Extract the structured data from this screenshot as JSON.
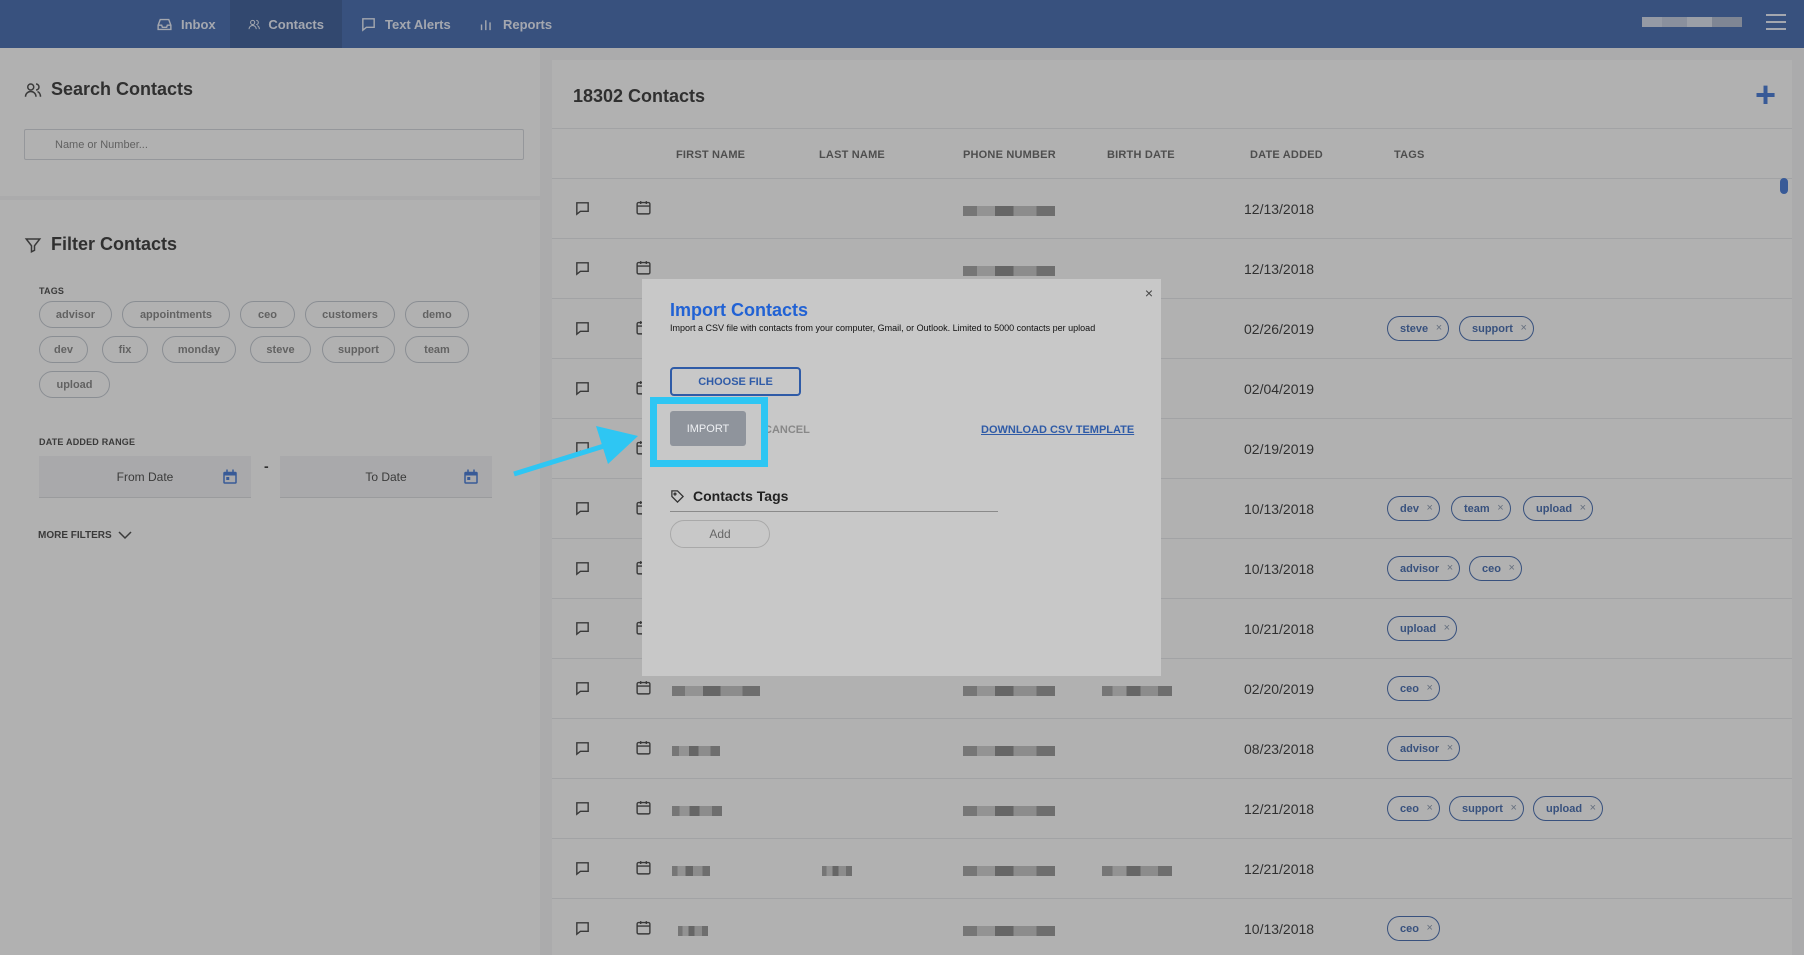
{
  "nav": {
    "items": [
      {
        "label": "Inbox",
        "icon": "inbox-icon"
      },
      {
        "label": "Contacts",
        "icon": "users-icon",
        "active": true
      },
      {
        "label": "Text Alerts",
        "icon": "chat-icon"
      },
      {
        "label": "Reports",
        "icon": "bar-chart-icon"
      }
    ]
  },
  "search": {
    "title": "Search Contacts",
    "placeholder": "Name or Number..."
  },
  "filter": {
    "title": "Filter Contacts",
    "tags_label": "TAGS",
    "tags": [
      "advisor",
      "appointments",
      "ceo",
      "customers",
      "demo",
      "dev",
      "fix",
      "monday",
      "steve",
      "support",
      "team",
      "upload"
    ],
    "date_range_label": "DATE ADDED RANGE",
    "from_date": "From Date",
    "to_date": "To Date",
    "dash": "-",
    "more_filters": "MORE FILTERS"
  },
  "contacts": {
    "title": "18302 Contacts",
    "add_label": "+",
    "columns": [
      "FIRST NAME",
      "LAST NAME",
      "PHONE NUMBER",
      "BIRTH DATE",
      "DATE ADDED",
      "TAGS"
    ],
    "rows": [
      {
        "date_added": "12/13/2018",
        "tags": []
      },
      {
        "date_added": "12/13/2018",
        "tags": []
      },
      {
        "date_added": "02/26/2019",
        "tags": [
          "steve",
          "support"
        ]
      },
      {
        "date_added": "02/04/2019",
        "tags": []
      },
      {
        "date_added": "02/19/2019",
        "tags": []
      },
      {
        "date_added": "10/13/2018",
        "tags": [
          "dev",
          "team",
          "upload"
        ]
      },
      {
        "date_added": "10/13/2018",
        "tags": [
          "advisor",
          "ceo"
        ]
      },
      {
        "date_added": "10/21/2018",
        "tags": [
          "upload"
        ]
      },
      {
        "date_added": "02/20/2019",
        "tags": [
          "ceo"
        ]
      },
      {
        "date_added": "08/23/2018",
        "tags": [
          "advisor"
        ]
      },
      {
        "date_added": "12/21/2018",
        "tags": [
          "ceo",
          "support",
          "upload"
        ]
      },
      {
        "date_added": "12/21/2018",
        "tags": []
      },
      {
        "date_added": "10/13/2018",
        "tags": [
          "ceo"
        ]
      }
    ]
  },
  "modal": {
    "close": "×",
    "title": "Import Contacts",
    "description": "Import a CSV file with contacts from your computer, Gmail, or Outlook. Limited to 5000 contacts per upload",
    "choose_file": "CHOOSE FILE",
    "import": "IMPORT",
    "cancel": "CANCEL",
    "download_template": "DOWNLOAD CSV TEMPLATE",
    "tags_title": "Contacts Tags",
    "add_tag": "Add"
  },
  "colors": {
    "nav_bg": "#2f5ba7",
    "accent": "#2162d4",
    "highlight": "#2ec6f3"
  }
}
